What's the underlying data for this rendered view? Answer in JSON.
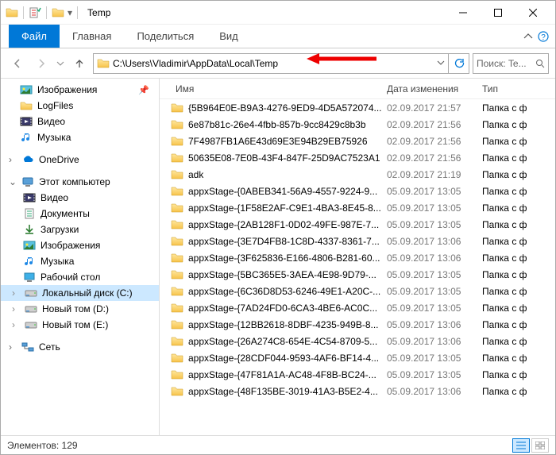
{
  "window": {
    "title": "Temp"
  },
  "tabs": {
    "file": "Файл",
    "home": "Главная",
    "share": "Поделиться",
    "view": "Вид"
  },
  "address": {
    "path": "C:\\Users\\Vladimir\\AppData\\Local\\Temp"
  },
  "search": {
    "placeholder": "Поиск: Te..."
  },
  "sidebar": {
    "quick": [
      {
        "label": "Изображения",
        "pin": true,
        "icon": "pictures"
      },
      {
        "label": "LogFiles",
        "pin": false,
        "icon": "folder"
      },
      {
        "label": "Видео",
        "pin": false,
        "icon": "video"
      },
      {
        "label": "Музыка",
        "pin": false,
        "icon": "music"
      }
    ],
    "onedrive": {
      "label": "OneDrive"
    },
    "thispc": {
      "label": "Этот компьютер",
      "items": [
        {
          "label": "Видео",
          "icon": "video"
        },
        {
          "label": "Документы",
          "icon": "docs"
        },
        {
          "label": "Загрузки",
          "icon": "downloads"
        },
        {
          "label": "Изображения",
          "icon": "pictures"
        },
        {
          "label": "Музыка",
          "icon": "music"
        },
        {
          "label": "Рабочий стол",
          "icon": "desktop"
        },
        {
          "label": "Локальный диск (C:)",
          "icon": "disk",
          "selected": true
        },
        {
          "label": "Новый том (D:)",
          "icon": "disk"
        },
        {
          "label": "Новый том (E:)",
          "icon": "disk"
        }
      ]
    },
    "network": {
      "label": "Сеть"
    }
  },
  "columns": {
    "name": "Имя",
    "date": "Дата изменения",
    "type": "Тип"
  },
  "files": [
    {
      "name": "{5B964E0E-B9A3-4276-9ED9-4D5A572074...",
      "date": "02.09.2017 21:57",
      "type": "Папка с ф"
    },
    {
      "name": "6e87b81c-26e4-4fbb-857b-9cc8429c8b3b",
      "date": "02.09.2017 21:56",
      "type": "Папка с ф"
    },
    {
      "name": "7F4987FB1A6E43d69E3E94B29EB75926",
      "date": "02.09.2017 21:56",
      "type": "Папка с ф"
    },
    {
      "name": "50635E08-7E0B-43F4-847F-25D9AC7523A1",
      "date": "02.09.2017 21:56",
      "type": "Папка с ф"
    },
    {
      "name": "adk",
      "date": "02.09.2017 21:19",
      "type": "Папка с ф"
    },
    {
      "name": "appxStage-{0ABEB341-56A9-4557-9224-9...",
      "date": "05.09.2017 13:05",
      "type": "Папка с ф"
    },
    {
      "name": "appxStage-{1F58E2AF-C9E1-4BA3-8E45-8...",
      "date": "05.09.2017 13:05",
      "type": "Папка с ф"
    },
    {
      "name": "appxStage-{2AB128F1-0D02-49FE-987E-7...",
      "date": "05.09.2017 13:05",
      "type": "Папка с ф"
    },
    {
      "name": "appxStage-{3E7D4FB8-1C8D-4337-8361-7...",
      "date": "05.09.2017 13:06",
      "type": "Папка с ф"
    },
    {
      "name": "appxStage-{3F625836-E166-4806-B281-60...",
      "date": "05.09.2017 13:06",
      "type": "Папка с ф"
    },
    {
      "name": "appxStage-{5BC365E5-3AEA-4E98-9D79-...",
      "date": "05.09.2017 13:05",
      "type": "Папка с ф"
    },
    {
      "name": "appxStage-{6C36D8D53-6246-49E1-A20C-...",
      "date": "05.09.2017 13:05",
      "type": "Папка с ф"
    },
    {
      "name": "appxStage-{7AD24FD0-6CA3-4BE6-AC0C...",
      "date": "05.09.2017 13:05",
      "type": "Папка с ф"
    },
    {
      "name": "appxStage-{12BB2618-8DBF-4235-949B-8...",
      "date": "05.09.2017 13:06",
      "type": "Папка с ф"
    },
    {
      "name": "appxStage-{26A274C8-654E-4C54-8709-5...",
      "date": "05.09.2017 13:06",
      "type": "Папка с ф"
    },
    {
      "name": "appxStage-{28CDF044-9593-4AF6-BF14-4...",
      "date": "05.09.2017 13:05",
      "type": "Папка с ф"
    },
    {
      "name": "appxStage-{47F81A1A-AC48-4F8B-BC24-...",
      "date": "05.09.2017 13:05",
      "type": "Папка с ф"
    },
    {
      "name": "appxStage-{48F135BE-3019-41A3-B5E2-4...",
      "date": "05.09.2017 13:06",
      "type": "Папка с ф"
    }
  ],
  "status": {
    "count_label": "Элементов:",
    "count": "129"
  }
}
